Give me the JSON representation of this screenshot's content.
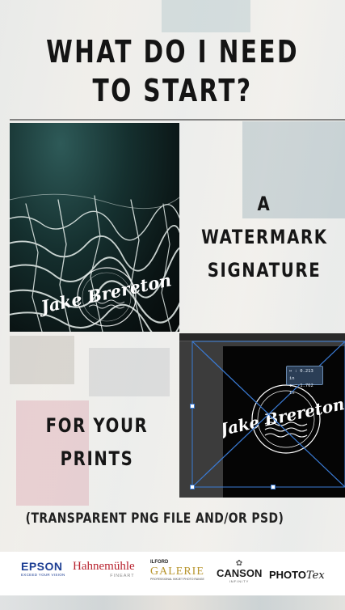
{
  "headline": {
    "line1": "WHAT DO I NEED",
    "line2": "TO START?"
  },
  "watermark_photo": {
    "signature": "Jake Brereton"
  },
  "caption_top": {
    "line1": "A",
    "line2": "WATERMARK",
    "line3": "SIGNATURE"
  },
  "editor_preview": {
    "signature": "Jake Brereton",
    "info_line1": "↔ : 0.213 in",
    "info_line2": "↕ : 1.762 in"
  },
  "caption_bottom": {
    "line1": "FOR YOUR",
    "line2": "PRINTS"
  },
  "file_note": "(TRANSPARENT PNG FILE AND/OR PSD)",
  "logos": {
    "epson_name": "EPSON",
    "epson_tag": "EXCEED YOUR VISION",
    "hahnemuhle_name": "Hahnemühle",
    "hahnemuhle_tag": "FINEART",
    "ilford_top": "ILFORD",
    "ilford_name": "GALERIE",
    "ilford_tag": "PROFESSIONAL INKJET PHOTO RANGE",
    "canson_name": "CANSON",
    "canson_tag": "INFINITY",
    "photo_a": "PHOTO",
    "photo_b": "Tex"
  },
  "colors": {
    "headline": "#141414",
    "epson_blue": "#1e3f94",
    "hahnemuhle_red": "#b8232f",
    "ilford_gold": "#b8952d",
    "selection_blue": "#3a7bd5"
  }
}
